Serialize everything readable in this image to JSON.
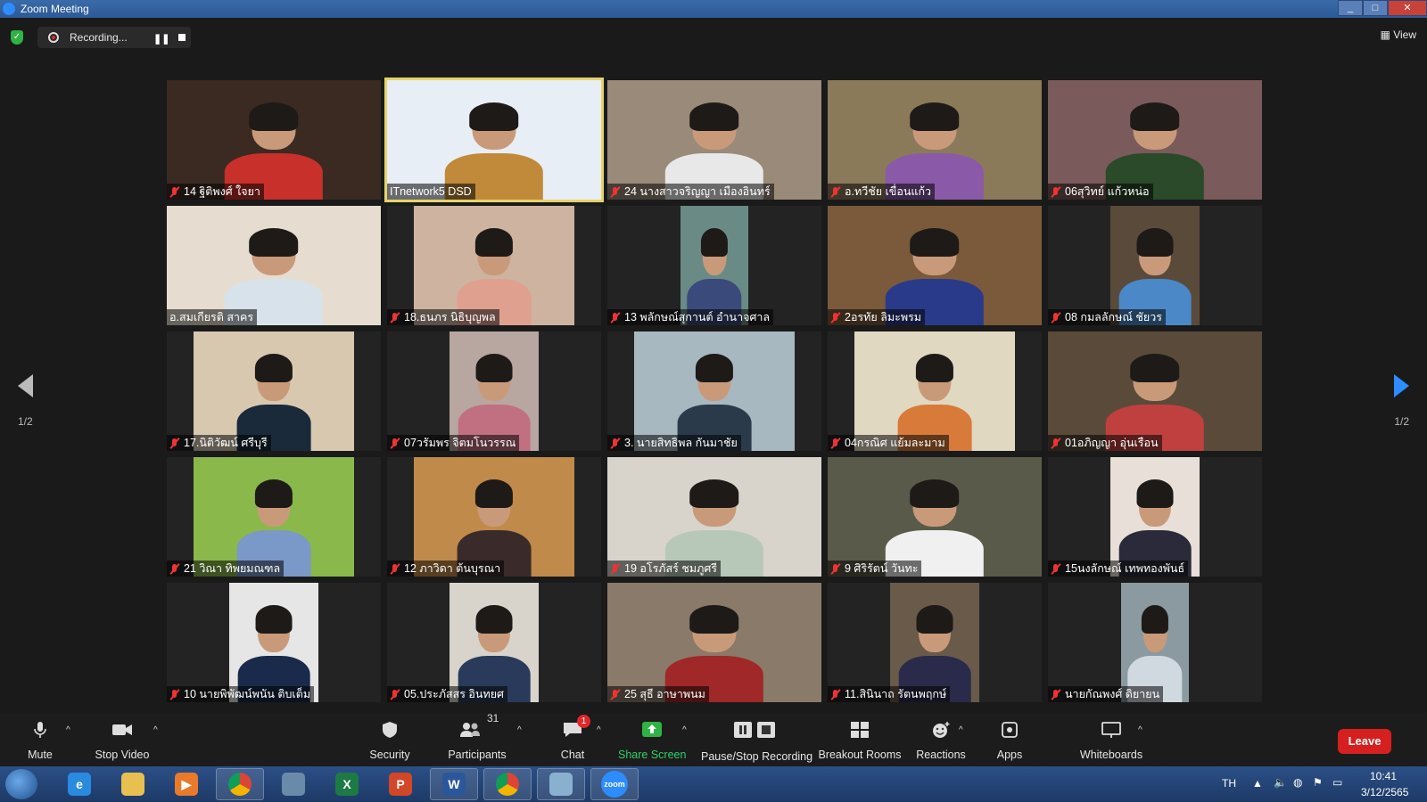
{
  "window": {
    "title": "Zoom Meeting"
  },
  "topbar": {
    "recording_label": "Recording...",
    "view_label": "View"
  },
  "pagination": {
    "left": "1/2",
    "right": "1/2"
  },
  "participants": [
    {
      "name": "14 ฐิติพงศ์ ใจยา",
      "muted": true,
      "bg": "#3a2a22",
      "shirt": "#c8302c",
      "video_w": 1.0
    },
    {
      "name": "ITnetwork5 DSD",
      "muted": false,
      "bg": "#e8eef6",
      "shirt": "#c08a3a",
      "video_w": 1.0,
      "active": true
    },
    {
      "name": "24 นางสาวจริญญา  เมืองอินทร์",
      "muted": true,
      "bg": "#9a8a7a",
      "shirt": "#e8e8e8",
      "video_w": 1.0
    },
    {
      "name": "อ.ทวีชัย เขื่อนแก้ว",
      "muted": true,
      "bg": "#8a7a5a",
      "shirt": "#8a5aa8",
      "video_w": 1.0
    },
    {
      "name": "06สุวิทย์ แก้วหน่อ",
      "muted": true,
      "bg": "#7a5a5a",
      "shirt": "#2a4a2a",
      "video_w": 1.0
    },
    {
      "name": "อ.สมเกียรติ สาคร",
      "muted": false,
      "bg": "#e6ddd0",
      "shirt": "#d8e2ea",
      "video_w": 1.0
    },
    {
      "name": "18.ธนภร นิธิบุญพล",
      "muted": true,
      "bg": "#cdb3a0",
      "shirt": "#e0a090",
      "video_w": 0.75
    },
    {
      "name": "13 พลักษณ์สุกานต์ อำนาจศาล",
      "muted": true,
      "bg": "#6a8a86",
      "shirt": "#3a4a7a",
      "video_w": 0.32
    },
    {
      "name": "2อรทัย ลิมะพรม",
      "muted": true,
      "bg": "#7a5a3a",
      "shirt": "#2a3a8a",
      "video_w": 1.0
    },
    {
      "name": "08 กมลลักษณ์ ชัยวร",
      "muted": true,
      "bg": "#5a4a3a",
      "shirt": "#4a88c8",
      "video_w": 0.42
    },
    {
      "name": "17.นิติวัฒน์ ศรีบุรี",
      "muted": true,
      "bg": "#d8c8b0",
      "shirt": "#1a2a3a",
      "video_w": 0.75
    },
    {
      "name": "07วรัมพร จิตมโนวรรณ",
      "muted": true,
      "bg": "#b8a6a0",
      "shirt": "#c07080",
      "video_w": 0.42
    },
    {
      "name": "3. นายสิทธิพล กันมาชัย",
      "muted": true,
      "bg": "#a8b8c0",
      "shirt": "#2a3a4a",
      "video_w": 0.75
    },
    {
      "name": "04กรณิศ แย้มละมาม",
      "muted": true,
      "bg": "#e0d8c0",
      "shirt": "#d87a3a",
      "video_w": 0.75
    },
    {
      "name": "01อภิญญา อุ่นเรือน",
      "muted": true,
      "bg": "#5a4a3a",
      "shirt": "#c04040",
      "video_w": 1.0
    },
    {
      "name": "21 วิณา  ทิพยมณฑล",
      "muted": true,
      "bg": "#8ab84a",
      "shirt": "#7a98c8",
      "video_w": 0.75
    },
    {
      "name": "12 ภาวิดา  ต้นบุรณา",
      "muted": true,
      "bg": "#c08a4a",
      "shirt": "#3a2a2a",
      "video_w": 0.75
    },
    {
      "name": "19 อโรภัสร์ ชมภูศรี",
      "muted": true,
      "bg": "#d8d4cc",
      "shirt": "#b8c8b8",
      "video_w": 1.0
    },
    {
      "name": "9 ศิริรัตน์ วันทะ",
      "muted": true,
      "bg": "#5a5a4a",
      "shirt": "#f0f0f0",
      "video_w": 1.0
    },
    {
      "name": "15นงลักษณ์ เทพทองพันธ์",
      "muted": true,
      "bg": "#e8e0d8",
      "shirt": "#2a2a3a",
      "video_w": 0.42
    },
    {
      "name": "10 นายพิพัฒน์พนัน ติบเต็ม",
      "muted": true,
      "bg": "#e6e6e6",
      "shirt": "#1a2a4a",
      "video_w": 0.42
    },
    {
      "name": "05.ประภัสสร อินทยศ",
      "muted": true,
      "bg": "#d8d4cc",
      "shirt": "#2a3a5a",
      "video_w": 0.42
    },
    {
      "name": "25 สุธี อาษาพนม",
      "muted": true,
      "bg": "#8a7a6a",
      "shirt": "#a02828",
      "video_w": 1.0
    },
    {
      "name": "11.สินินาถ รัตนพฤกษ์",
      "muted": true,
      "bg": "#6a5a4a",
      "shirt": "#2a2a4a",
      "video_w": 0.42
    },
    {
      "name": "นายกัณพงศ์ ดิยายน",
      "muted": true,
      "bg": "#8a9aa0",
      "shirt": "#d0d8e0",
      "video_w": 0.32
    }
  ],
  "toolbar": {
    "mute": "Mute",
    "stop_video": "Stop Video",
    "security": "Security",
    "participants": "Participants",
    "participants_count": "31",
    "chat": "Chat",
    "chat_badge": "1",
    "share_screen": "Share Screen",
    "pause_stop_recording": "Pause/Stop Recording",
    "breakout_rooms": "Breakout Rooms",
    "reactions": "Reactions",
    "apps": "Apps",
    "whiteboards": "Whiteboards",
    "leave": "Leave"
  },
  "taskbar": {
    "apps": [
      {
        "name": "internet-explorer",
        "glyph": "e",
        "color": "#2a8ae0"
      },
      {
        "name": "file-explorer",
        "glyph": "",
        "color": "#e8c050"
      },
      {
        "name": "media-player",
        "glyph": "▶",
        "color": "#e87a2a"
      },
      {
        "name": "chrome",
        "glyph": "",
        "color": "#2a9a4a"
      },
      {
        "name": "app-generic",
        "glyph": "",
        "color": "#6a8aaa"
      },
      {
        "name": "excel",
        "glyph": "X",
        "color": "#1d7a45"
      },
      {
        "name": "powerpoint",
        "glyph": "P",
        "color": "#d24726"
      },
      {
        "name": "word",
        "glyph": "W",
        "color": "#2b579a"
      },
      {
        "name": "chrome",
        "glyph": "",
        "color": "#2a9a4a"
      },
      {
        "name": "notepad",
        "glyph": "",
        "color": "#8ab0d0"
      },
      {
        "name": "zoom",
        "glyph": "zoom",
        "color": "#2d8cff"
      }
    ],
    "lang": "TH",
    "time": "10:41",
    "date": "3/12/2565"
  }
}
